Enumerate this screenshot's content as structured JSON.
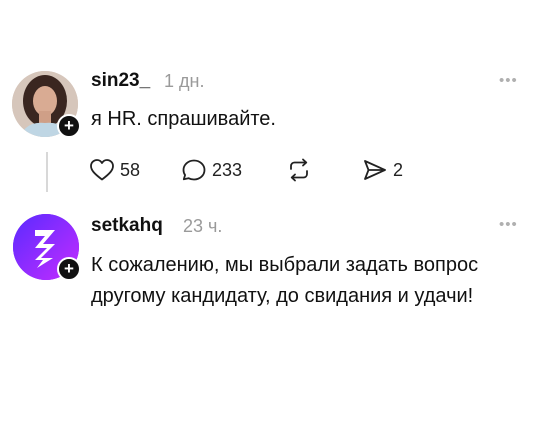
{
  "posts": [
    {
      "username": "sin23_",
      "time": "1 дн.",
      "text": "я HR. спрашивайте.",
      "more": "•••",
      "actions": {
        "likes": "58",
        "comments": "233",
        "reposts": "",
        "shares": "2"
      }
    },
    {
      "username": "setkahq",
      "time": "23 ч.",
      "text": "К сожалению, мы выбрали задать вопрос другому кандидату, до свидания и удачи!",
      "more": "•••"
    }
  ]
}
